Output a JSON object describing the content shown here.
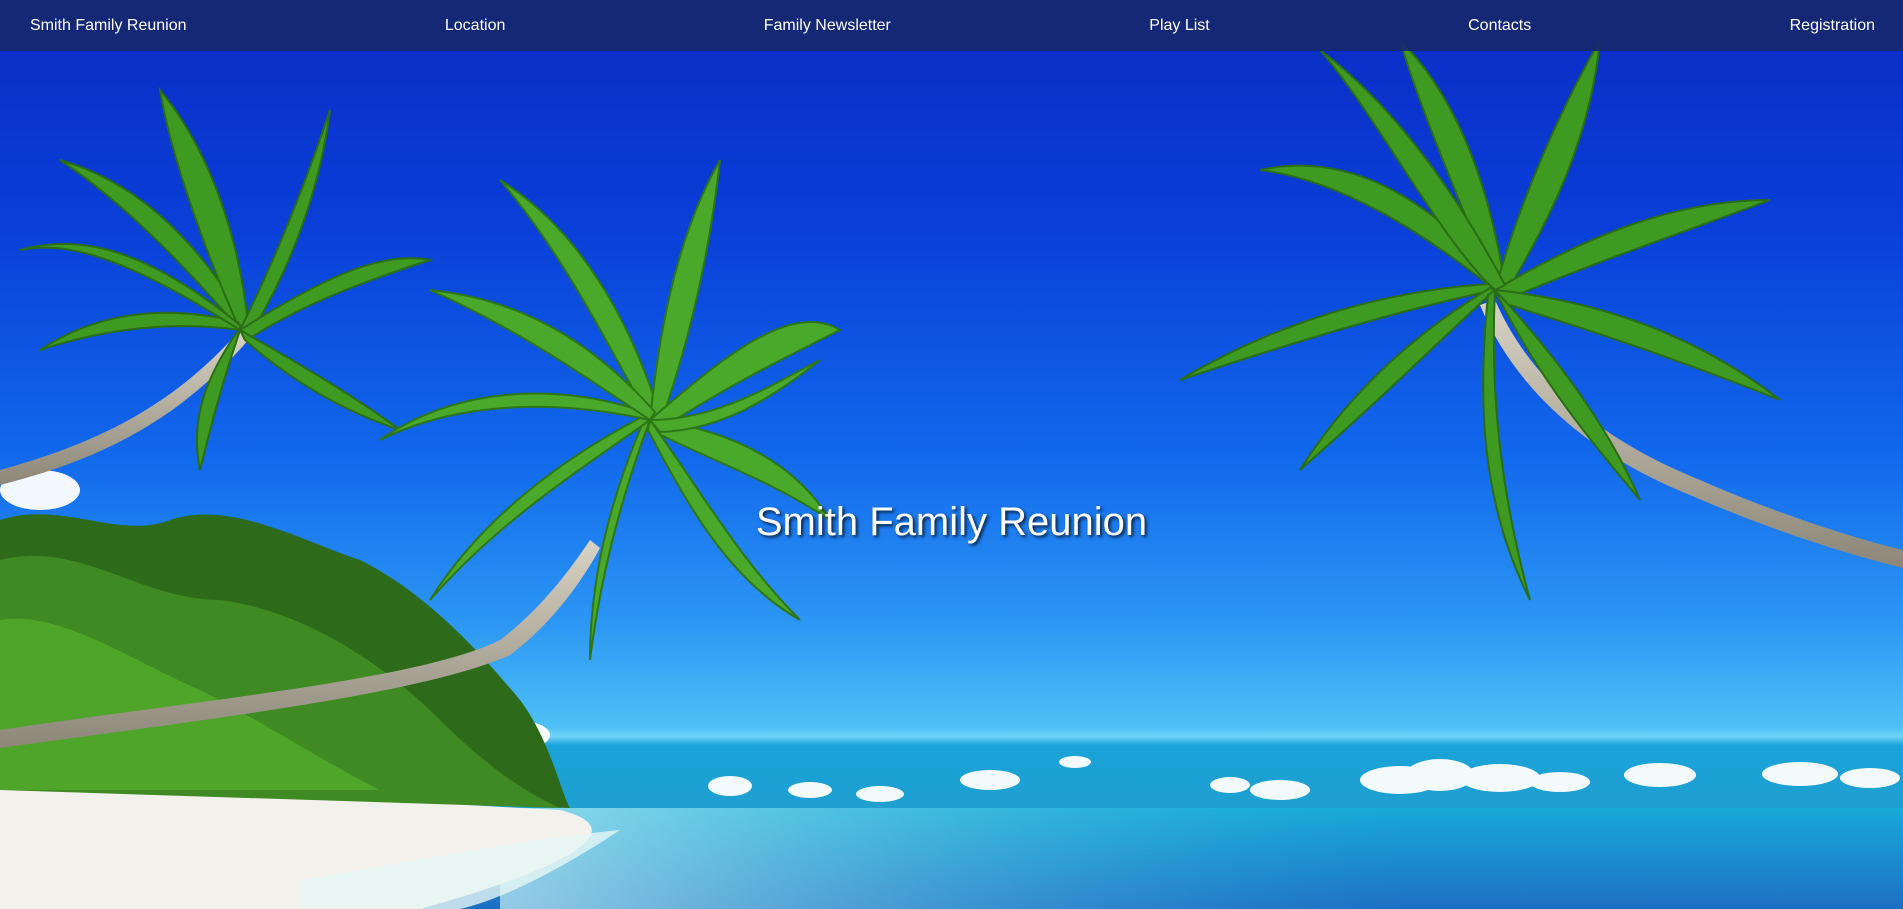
{
  "header": {
    "brand": "Smith Family Reunion",
    "nav": [
      {
        "label": "Location"
      },
      {
        "label": "Family Newsletter"
      },
      {
        "label": "Play List"
      },
      {
        "label": "Contacts"
      },
      {
        "label": "Registration"
      }
    ]
  },
  "hero": {
    "title": "Smith Family Reunion"
  },
  "theme": {
    "nav_bg": "#16286e",
    "sky_top": "#0a2bc4",
    "sky_bottom": "#4ec0f6",
    "sea": "#1f9ecf",
    "sand": "#f2f0ea",
    "palm": "#3f9a22"
  }
}
